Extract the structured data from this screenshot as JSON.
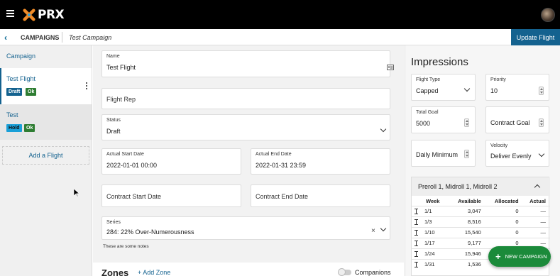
{
  "app": {
    "logo_text": "PRX"
  },
  "subheader": {
    "back": "‹",
    "crumb": "CAMPAIGNS",
    "crumb_current": "Test Campaign",
    "update_button": "Update Flight"
  },
  "sidebar": {
    "campaign_link": "Campaign",
    "flights": [
      {
        "name": "Test Flight",
        "badges": [
          "Draft",
          "Ok"
        ]
      },
      {
        "name": "Test",
        "badges": [
          "Hold",
          "Ok"
        ]
      }
    ],
    "add_flight": "Add a Flight"
  },
  "form": {
    "name": {
      "label": "Name",
      "value": "Test Flight"
    },
    "flight_rep": {
      "placeholder": "Flight Rep"
    },
    "status": {
      "label": "Status",
      "value": "Draft"
    },
    "actual_start": {
      "label": "Actual Start Date",
      "value": "2022-01-01 00:00"
    },
    "actual_end": {
      "label": "Actual End Date",
      "value": "2022-01-31 23:59"
    },
    "contract_start": {
      "placeholder": "Contract Start Date"
    },
    "contract_end": {
      "placeholder": "Contract End Date"
    },
    "series": {
      "label": "Series",
      "value": "284: 22% Over-Numerousness",
      "clear": "×"
    },
    "notes": "These are some notes"
  },
  "zones": {
    "title": "Zones",
    "add_zone": "+ Add Zone",
    "companions": "Companions"
  },
  "impressions": {
    "title": "Impressions",
    "flight_type": {
      "label": "Flight Type",
      "value": "Capped"
    },
    "priority": {
      "label": "Priority",
      "value": "10"
    },
    "total_goal": {
      "label": "Total Goal",
      "value": "5000"
    },
    "contract_goal": {
      "placeholder": "Contract Goal"
    },
    "daily_minimum": {
      "placeholder": "Daily Minimum"
    },
    "velocity": {
      "label": "Velocity",
      "value": "Deliver Evenly"
    },
    "zone_card": {
      "title": "Preroll 1, Midroll 1, Midroll 2",
      "columns": [
        "Week",
        "Available",
        "Allocated",
        "Actual"
      ],
      "rows": [
        {
          "week": "1/1",
          "available": "3,047",
          "allocated": "0",
          "actual": "—"
        },
        {
          "week": "1/3",
          "available": "8,516",
          "allocated": "0",
          "actual": "—"
        },
        {
          "week": "1/10",
          "available": "15,540",
          "allocated": "0",
          "actual": "—"
        },
        {
          "week": "1/17",
          "available": "9,177",
          "allocated": "0",
          "actual": "—"
        },
        {
          "week": "1/24",
          "available": "15,946",
          "allocated": "0",
          "actual": "—"
        },
        {
          "week": "1/31",
          "available": "1,536",
          "allocated": "0",
          "actual": "—"
        }
      ]
    }
  },
  "fab": {
    "label": "NEW CAMPAIGN",
    "plus": "+"
  },
  "colors": {
    "topbar": "#000000",
    "accent": "#14628f",
    "ok": "#2e7d32",
    "hold": "#1aa0d8",
    "fab": "#1b8a3a",
    "logo_orange": "#f28c28",
    "logo_blue": "#2ea3dc"
  }
}
